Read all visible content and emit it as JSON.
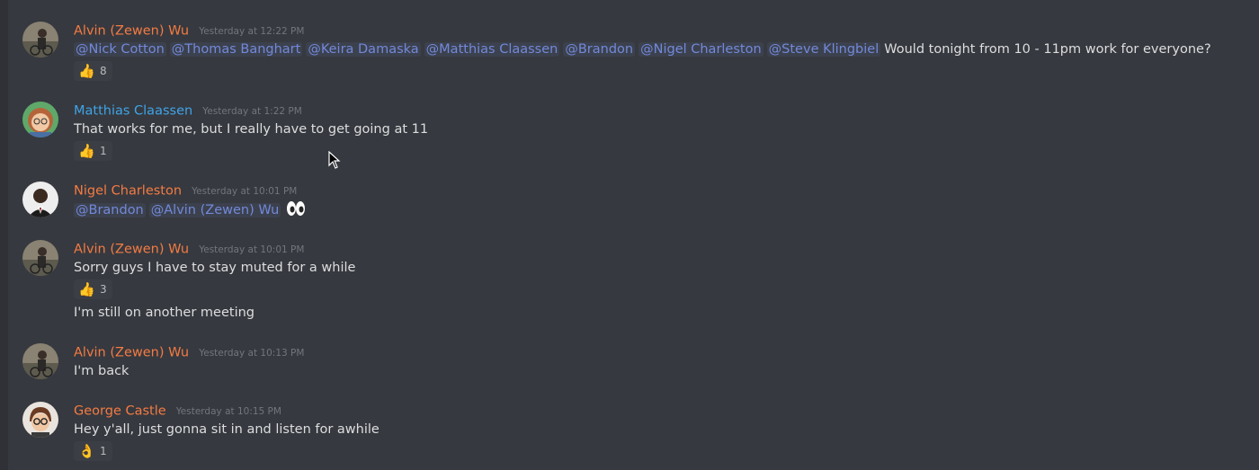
{
  "colors": {
    "background": "#36393f",
    "orange_name": "#f47b43",
    "blue_name": "#3fa4e8",
    "mention": "#7289da",
    "timestamp": "#72767d"
  },
  "messages": [
    {
      "author": "Alvin (Zewen) Wu",
      "name_color": "#f47b43",
      "timestamp": "Yesterday at 12:22 PM",
      "mentions": [
        "@Nick Cotton",
        "@Thomas Banghart",
        "@Keira Damaska",
        "@Matthias Claassen",
        "@Brandon",
        "@Nigel Charleston",
        "@Steve Klingbiel"
      ],
      "text": "Would tonight from 10 - 11pm work for everyone?",
      "reaction": {
        "emoji": "👍",
        "icon": "thumbs-up-icon",
        "count": "8"
      }
    },
    {
      "author": "Matthias Claassen",
      "name_color": "#3fa4e8",
      "timestamp": "Yesterday at 1:22 PM",
      "text": "That works for me, but I really have to get going at 11",
      "reaction": {
        "emoji": "👍",
        "icon": "thumbs-up-icon",
        "count": "1"
      }
    },
    {
      "author": "Nigel Charleston",
      "name_color": "#f47b43",
      "timestamp": "Yesterday at 10:01 PM",
      "mentions": [
        "@Brandon",
        "@Alvin (Zewen) Wu"
      ],
      "emoji_icon": "eyes-icon"
    },
    {
      "author": "Alvin (Zewen) Wu",
      "name_color": "#f47b43",
      "timestamp": "Yesterday at 10:01 PM",
      "text": "Sorry guys I have to stay muted for a while",
      "reaction": {
        "emoji": "👍",
        "icon": "thumbs-up-icon",
        "count": "3"
      },
      "followup": "I'm still on another meeting"
    },
    {
      "author": "Alvin (Zewen) Wu",
      "name_color": "#f47b43",
      "timestamp": "Yesterday at 10:13 PM",
      "text": "I'm back"
    },
    {
      "author": "George Castle",
      "name_color": "#f47b43",
      "timestamp": "Yesterday at 10:15 PM",
      "text": "Hey y'all, just gonna sit in and listen for awhile",
      "reaction": {
        "emoji": "👌",
        "icon": "ok-hand-icon",
        "count": "1"
      }
    }
  ]
}
